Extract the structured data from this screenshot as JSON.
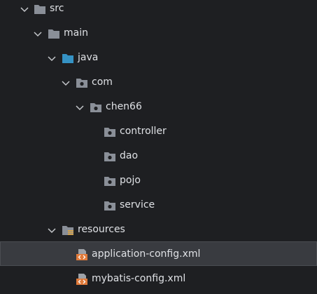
{
  "tree": {
    "src": "src",
    "main": "main",
    "java": "java",
    "com": "com",
    "chen66": "chen66",
    "controller": "controller",
    "dao": "dao",
    "pojo": "pojo",
    "service": "service",
    "resources": "resources",
    "application_config": "application-config.xml",
    "mybatis_config": "mybatis-config.xml",
    "selected": "application-config.xml"
  },
  "icons": {
    "chevron": "chevron-down-icon",
    "folder": "folder-icon",
    "source_root": "source-root-folder-icon",
    "package": "package-icon",
    "resources_root": "resources-root-folder-icon",
    "xml": "xml-file-icon"
  },
  "colors": {
    "background": "#1e1f22",
    "text": "#dfe1e5",
    "folder": "#8a8f98",
    "source_root": "#3592c4",
    "xml": "#e07a3a",
    "selection": "#393b40"
  }
}
